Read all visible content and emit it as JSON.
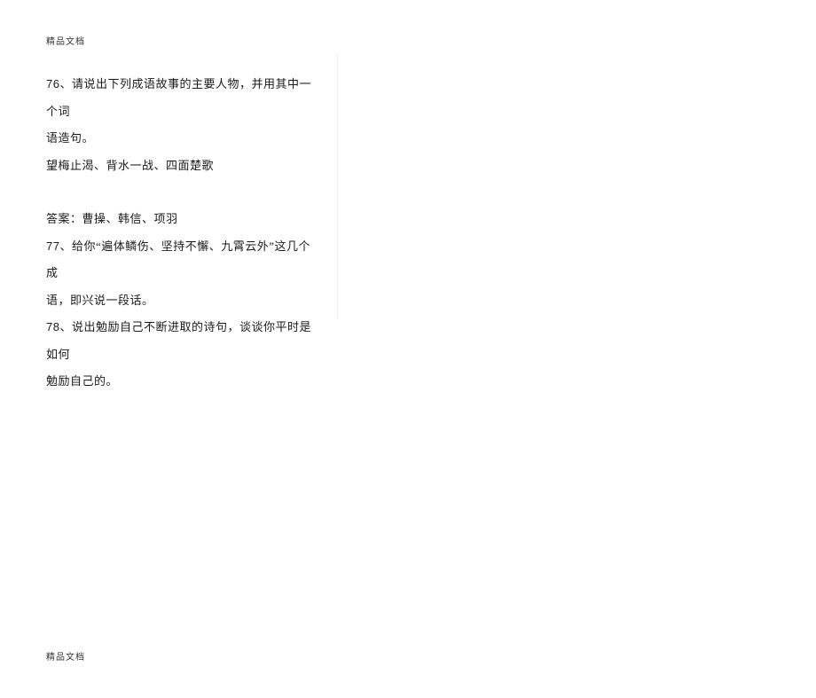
{
  "header": {
    "label": "精品文档"
  },
  "footer": {
    "label": "精品文档"
  },
  "content": {
    "q76_num": "76",
    "q76_line1": "、请说出下列成语故事的主要人物，并用其中一个词",
    "q76_line2": "语造句。",
    "q76_line3": "望梅止渴、背水一战、四面楚歌",
    "answer_line": "答案：曹操、韩信、项羽",
    "q77_num": "77",
    "q77_line1": "、给你“遍体鳞伤、坚持不懈、九霄云外”这几个成",
    "q77_line2": "语，即兴说一段话。",
    "q78_num": "78",
    "q78_line1": "、说出勉励自己不断进取的诗句，谈谈你平时是如何",
    "q78_line2": "勉励自己的。"
  }
}
